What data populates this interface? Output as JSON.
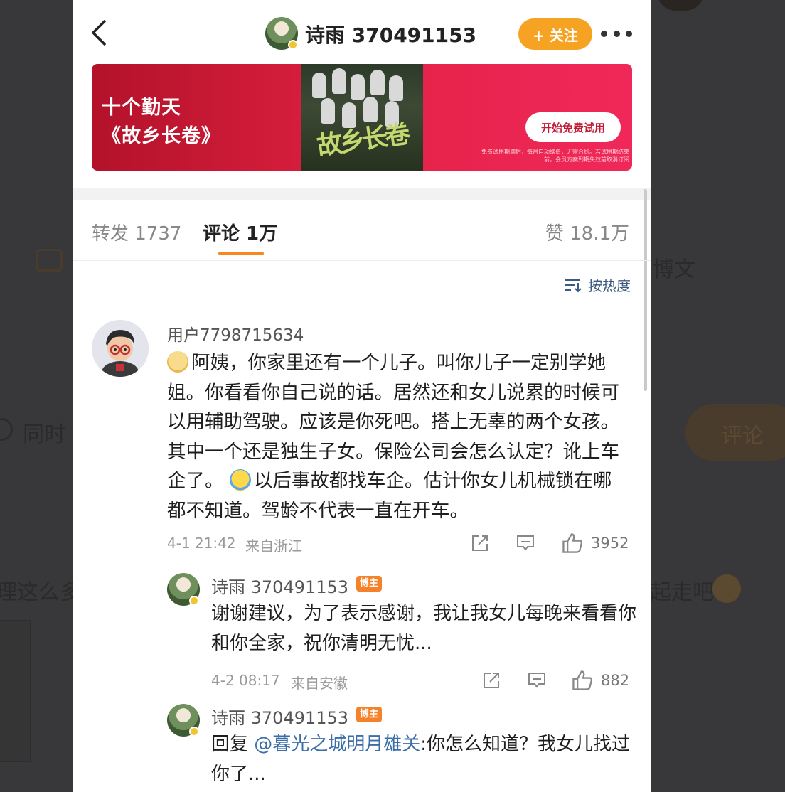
{
  "header": {
    "username": "诗雨 370491153",
    "follow_label": "+ 关注"
  },
  "banner": {
    "title_line1": "十个勤天",
    "title_line2": "《故乡长卷》",
    "poster_script": "故乡长卷",
    "cta_label": "开始免费试用",
    "fine_print": "免费试用期满后，每月自动续费，无需合约。若试用期结束前，会员方案到期失效前取消订阅"
  },
  "tabs": {
    "forward": "转发 1737",
    "comment": "评论 1万",
    "like": "赞 18.1万"
  },
  "sort": {
    "label": "按热度"
  },
  "comment": {
    "user": "用户7798715634",
    "text_part1": "阿姨，你家里还有一个儿子。叫你儿子一定别学她姐。你看看你自己说的话。居然还和女儿说累的时候可以用辅助驾驶。应该是你死吧。搭上无辜的两个女孩。其中一个还是独生子女。保险公司会怎么认定？讹上车企了。",
    "text_part2": "以后事故都找车企。估计你女儿机械锁在哪都不知道。驾龄不代表一直在开车。",
    "time": "4-1 21:42",
    "location": "来自浙江",
    "likes": "3952"
  },
  "reply1": {
    "user": "诗雨 370491153",
    "badge": "博主",
    "text": "谢谢建议，为了表示感谢，我让我女儿每晚来看看你和你全家，祝你清明无忧...",
    "time": "4-2 08:17",
    "location": "来自安徽",
    "likes": "882"
  },
  "reply2": {
    "user": "诗雨 370491153",
    "badge": "博主",
    "prefix": "回复 ",
    "mention": "@暮光之城明月雄关",
    "text": ":你怎么知道？我女儿找过你了..."
  },
  "background": {
    "text_1": "博文",
    "text_2": "同时",
    "text_3": "评论",
    "text_4": "理这么多",
    "text_5": "起走吧"
  }
}
